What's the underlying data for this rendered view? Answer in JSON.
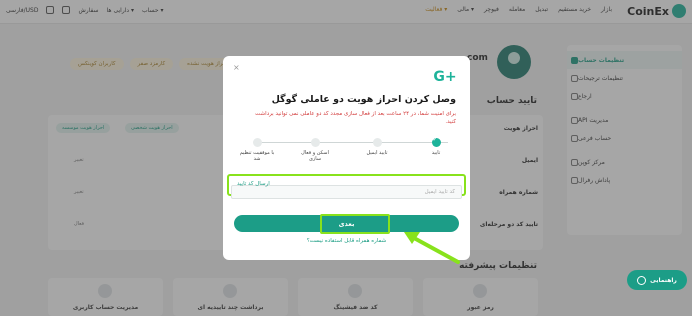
{
  "topbar": {
    "logo": "CoinEx",
    "nav": [
      "بازار",
      "خرید مستقیم",
      "تبدیل",
      "معامله",
      "فیوچر",
      "مالی ▾",
      "فعالیت ▾"
    ],
    "nav_left": [
      "فارسی/USD",
      "سفارش",
      "دارایی ها ▾",
      "حساب ▾"
    ]
  },
  "sidebar": {
    "items": [
      {
        "label": "تنظیمات حساب",
        "active": true
      },
      {
        "label": "تنظیمات ترجیحات",
        "active": false
      },
      {
        "label": "ارجاع",
        "active": false
      },
      {
        "label": "مدیریت API",
        "active": false
      },
      {
        "label": "حساب فرعی",
        "active": false
      },
      {
        "label": "مرکز کوپن",
        "active": false
      },
      {
        "label": "پاداش رفرال",
        "active": false
      }
    ]
  },
  "background": {
    "com_text": "com",
    "pills": [
      "احراز هویت نشده",
      "کارمزد صفر",
      "کاربران کوینکس"
    ],
    "verify_title": "تایید حساب",
    "advanced_title": "تنظیمات پیشرفته",
    "rows": [
      "احراز هویت",
      "ایمیل",
      "شماره همراه",
      "تایید کد دو مرحله‌ای"
    ],
    "tags": [
      "احراز هویت شخصی",
      "احراز هویت موسسه"
    ],
    "row_actions": [
      "تغییر",
      "تغییر",
      "فعال"
    ],
    "tiles": [
      "رمز عبور",
      "کد ضد فیشینگ",
      "برداشت چند تاییدیه ای",
      "مدیریت حساب کاربری"
    ]
  },
  "modal": {
    "close": "×",
    "logo": "G+",
    "title": "وصل کردن احراز هویت دو عاملی گوگل",
    "desc": "برای امنیت شما، در ۲۴ ساعت بعد از فعال سازی مجدد کد دو عاملی نمی توانید برداشت کنید.",
    "steps": [
      {
        "label": "تایید",
        "done": true
      },
      {
        "label": "تایید ایمیل",
        "done": false
      },
      {
        "label": "اسکن و فعال سازی",
        "done": false
      },
      {
        "label": "با موفقیت تنظیم شد",
        "done": false
      }
    ],
    "input_placeholder": "کد تایید ایمیل",
    "send_code": "ارسال کد تایید",
    "next": "بعدی",
    "phone_link": "شماره همراه قابل استفاده نیست؟"
  },
  "help": {
    "label": "راهنمایی"
  },
  "colors": {
    "accent": "#1c9d87",
    "highlight": "#88e21c",
    "warning": "#d23a3a"
  }
}
